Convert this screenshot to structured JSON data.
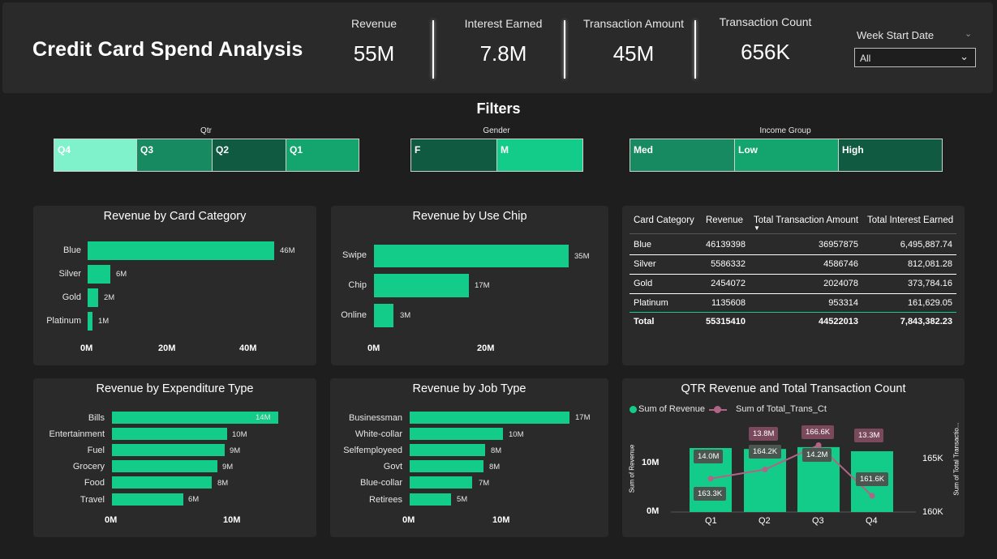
{
  "header": {
    "title": "Credit Card Spend Analysis",
    "kpis": [
      {
        "label": "Revenue",
        "value": "55M"
      },
      {
        "label": "Interest Earned",
        "value": "7.8M"
      },
      {
        "label": "Transaction Amount",
        "value": "45M"
      },
      {
        "label": "Transaction Count",
        "value": "656K"
      }
    ],
    "week_start": {
      "label": "Week Start Date",
      "value": "All"
    }
  },
  "filters": {
    "title": "Filters",
    "qtr": {
      "label": "Qtr",
      "items": [
        "Q4",
        "Q3",
        "Q2",
        "Q1"
      ]
    },
    "gender": {
      "label": "Gender",
      "items": [
        "F",
        "M"
      ]
    },
    "income": {
      "label": "Income Group",
      "items": [
        "Med",
        "Low",
        "High"
      ]
    }
  },
  "colors": {
    "bar": "#14cc8a",
    "line": "#b06486",
    "slicer_selected": "#7ff2cb",
    "slicer_mid": "#178a62",
    "slicer_dark": "#0f5a40"
  },
  "card_category": {
    "title": "Revenue by Card Category",
    "categories": [
      "Blue",
      "Silver",
      "Gold",
      "Platinum"
    ],
    "labels": [
      "46M",
      "6M",
      "2M",
      "1M"
    ],
    "values": [
      46,
      6,
      2,
      1
    ],
    "ticks": [
      "0M",
      "20M",
      "40M"
    ]
  },
  "use_chip": {
    "title": "Revenue by Use Chip",
    "categories": [
      "Swipe",
      "Chip",
      "Online"
    ],
    "labels": [
      "35M",
      "17M",
      "3M"
    ],
    "values": [
      35,
      17,
      3
    ],
    "ticks": [
      "0M",
      "20M"
    ]
  },
  "table": {
    "headers": [
      "Card Category",
      "Revenue",
      "Total Transaction Amount",
      "Total Interest Earned"
    ],
    "rows": [
      [
        "Blue",
        "46139398",
        "36957875",
        "6,495,887.74"
      ],
      [
        "Silver",
        "5586332",
        "4586746",
        "812,081.28"
      ],
      [
        "Gold",
        "2454072",
        "2024078",
        "373,784.16"
      ],
      [
        "Platinum",
        "1135608",
        "953314",
        "161,629.05"
      ]
    ],
    "total": [
      "Total",
      "55315410",
      "44522013",
      "7,843,382.23"
    ]
  },
  "expenditure": {
    "title": "Revenue by Expenditure Type",
    "categories": [
      "Bills",
      "Entertainment",
      "Fuel",
      "Grocery",
      "Food",
      "Travel"
    ],
    "labels": [
      "14M",
      "10M",
      "9M",
      "9M",
      "8M",
      "6M"
    ],
    "values": [
      14,
      9.6,
      9.3,
      8.7,
      8.2,
      6
    ],
    "ticks": [
      "0M",
      "10M"
    ]
  },
  "job_type": {
    "title": "Revenue by Job Type",
    "categories": [
      "Businessman",
      "White-collar",
      "Selfemployeed",
      "Govt",
      "Blue-collar",
      "Retirees"
    ],
    "labels": [
      "17M",
      "10M",
      "8M",
      "8M",
      "7M",
      "5M"
    ],
    "values": [
      17,
      9.8,
      8,
      7.8,
      6.5,
      4.4
    ],
    "ticks": [
      "0M",
      "10M"
    ]
  },
  "chart_data": {
    "type": "bar",
    "title": "QTR Revenue and Total Transaction Count",
    "categories": [
      "Q1",
      "Q2",
      "Q3",
      "Q4"
    ],
    "series": [
      {
        "name": "Sum of Revenue",
        "values": [
          14.0,
          13.8,
          14.2,
          13.3
        ],
        "labels": [
          "14.0M",
          "13.8M",
          "14.2M",
          "13.3M"
        ]
      },
      {
        "name": "Sum of Total_Trans_Ct",
        "values": [
          163.3,
          164.2,
          166.6,
          161.6
        ],
        "labels": [
          "163.3K",
          "164.2K",
          "166.6K",
          "161.6K"
        ]
      }
    ],
    "ylabel": "Sum of Revenue",
    "y2label": "Sum of Total Transactio...",
    "y_ticks": [
      "0M",
      "10M"
    ],
    "y2_ticks": [
      "160K",
      "165K"
    ],
    "ylim": [
      0,
      15.6
    ],
    "y2lim": [
      160,
      168
    ]
  }
}
